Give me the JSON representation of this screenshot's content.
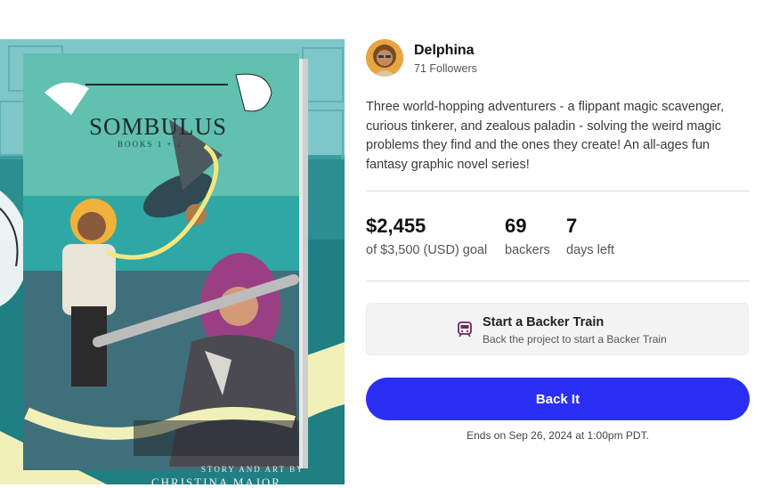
{
  "cover": {
    "title": "SOMBULUS",
    "subtitle": "BOOKS 1 + 2",
    "credit_line1": "STORY AND ART BY",
    "credit_line2": "CHRISTINA MAJOR"
  },
  "creator": {
    "name": "Delphina",
    "followers": "71 Followers",
    "avatar_icon": "creator-avatar"
  },
  "blurb": "Three world-hopping adventurers - a flippant magic scavenger, curious tinkerer, and zealous paladin - solving the weird magic problems they find and the ones they create! An all-ages fun fantasy graphic novel series!",
  "stats": {
    "pledged": "$2,455",
    "goal": "of $3,500 (USD) goal",
    "backers_count": "69",
    "backers_label": "backers",
    "days_count": "7",
    "days_label": "days left"
  },
  "backer_train": {
    "icon": "train-icon",
    "title": "Start a Backer Train",
    "subtitle": "Back the project to start a Backer Train"
  },
  "cta": {
    "label": "Back It",
    "color": "#2b2ff3"
  },
  "ends": "Ends on Sep 26, 2024 at 1:00pm PDT."
}
